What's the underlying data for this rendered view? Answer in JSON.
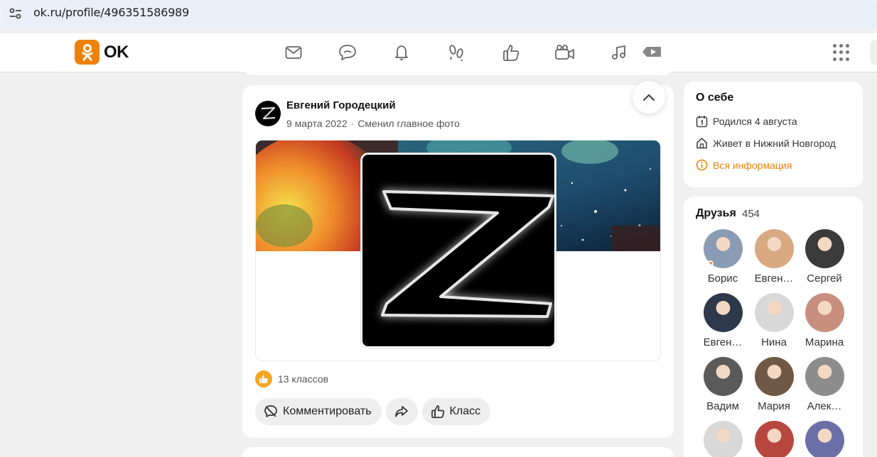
{
  "browser": {
    "url": "ok.ru/profile/496351586989",
    "site_info_icon": "tune-icon"
  },
  "header": {
    "logo_text": "OK",
    "brand_color": "#ee8208",
    "nav_icons": [
      "mail-icon",
      "chat-icon",
      "bell-icon",
      "footprints-icon",
      "thumbs-up-icon",
      "video-camera-icon",
      "music-icon",
      "video-play-icon"
    ],
    "apps_icon": "apps-grid-icon"
  },
  "post": {
    "author": "Евгений Городецкий",
    "date": "9 марта 2022",
    "activity": "Сменил главное фото",
    "likes_text": "13 классов",
    "actions": {
      "comment": "Комментировать",
      "share_icon": "share-icon",
      "like": "Класс"
    }
  },
  "about": {
    "title": "О себе",
    "birthday": "Родился 4 августа",
    "city": "Живет в Нижний Новгород",
    "all_info": "Вся информация"
  },
  "friends": {
    "title": "Друзья",
    "count": "454",
    "items": [
      {
        "name": "Борис",
        "color": "#8a9bb4",
        "online": true
      },
      {
        "name": "Евген…",
        "color": "#d9a982"
      },
      {
        "name": "Сергей",
        "color": "#3b3b3b"
      },
      {
        "name": "Евген…",
        "color": "#2e3a4c"
      },
      {
        "name": "Нина",
        "color": "#d8d8d8"
      },
      {
        "name": "Марина",
        "color": "#c98f7e"
      },
      {
        "name": "Вадим",
        "color": "#5a5a5a"
      },
      {
        "name": "Мария",
        "color": "#6f5845"
      },
      {
        "name": "Алек…",
        "color": "#8d8d8d"
      },
      {
        "name": "",
        "color": "#d8d8d8"
      },
      {
        "name": "",
        "color": "#b8473f"
      },
      {
        "name": "",
        "color": "#6b6fa8"
      }
    ]
  }
}
